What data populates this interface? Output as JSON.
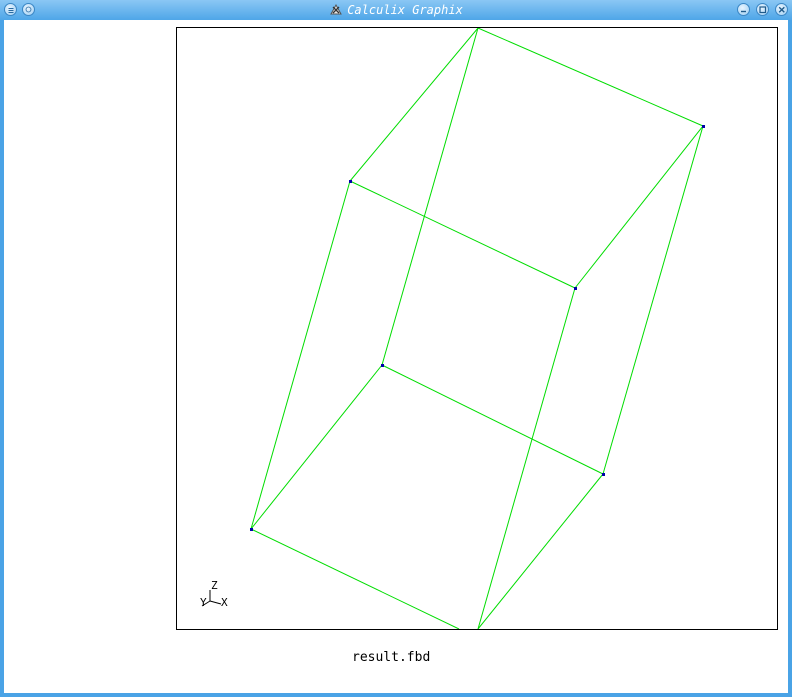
{
  "window": {
    "title": "Calculix Graphix"
  },
  "viewport": {
    "axis_labels": {
      "z": "Z",
      "y": "Y",
      "x": "X"
    },
    "line_color": "#00dd00",
    "node_color": "#0000aa"
  },
  "status": {
    "filename": "result.fbd"
  },
  "icons": {
    "menu": "menu-icon",
    "minimize": "minimize-icon",
    "maximize": "maximize-icon",
    "close": "close-icon",
    "app": "app-icon"
  }
}
